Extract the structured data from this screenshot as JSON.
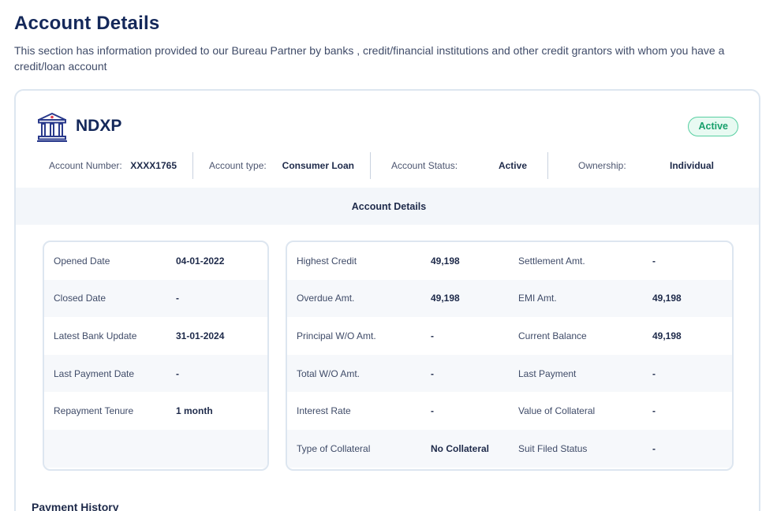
{
  "page": {
    "title": "Account Details",
    "description": "This section has information provided to our Bureau Partner by banks , credit/financial institutions and other credit grantors with whom you have a credit/loan account"
  },
  "account": {
    "bank_icon": "bank-building-icon",
    "name": "NDXP",
    "status_badge": "Active",
    "summary": [
      {
        "label": "Account Number:",
        "value": "XXXX1765"
      },
      {
        "label": "Account type:",
        "value": "Consumer Loan"
      },
      {
        "label": "Account Status:",
        "value": "Active"
      },
      {
        "label": "Ownership:",
        "value": "Individual"
      }
    ],
    "section_title": "Account Details",
    "left_details": [
      {
        "label": "Opened Date",
        "value": "04-01-2022"
      },
      {
        "label": "Closed Date",
        "value": "-"
      },
      {
        "label": "Latest Bank Update",
        "value": "31-01-2024"
      },
      {
        "label": "Last Payment Date",
        "value": "-"
      },
      {
        "label": "Repayment Tenure",
        "value": "1 month"
      },
      {
        "label": "",
        "value": ""
      }
    ],
    "right_details": [
      {
        "label1": "Highest Credit",
        "value1": "49,198",
        "label2": "Settlement Amt.",
        "value2": "-"
      },
      {
        "label1": "Overdue Amt.",
        "value1": "49,198",
        "label2": "EMI Amt.",
        "value2": "49,198"
      },
      {
        "label1": "Principal W/O Amt.",
        "value1": "-",
        "label2": "Current Balance",
        "value2": "49,198"
      },
      {
        "label1": "Total W/O Amt.",
        "value1": "-",
        "label2": "Last Payment",
        "value2": "-"
      },
      {
        "label1": "Interest Rate",
        "value1": "-",
        "label2": "Value of Collateral",
        "value2": "-"
      },
      {
        "label1": "Type of Collateral",
        "value1": "No Collateral",
        "label2": "Suit Filed Status",
        "value2": "-"
      }
    ],
    "payment_history_title": "Payment History"
  },
  "colors": {
    "title": "#14285a",
    "status_green": "#18a06c",
    "status_bg": "#e8faf2",
    "band_bg": "#f3f6fa",
    "border": "#dde6f0"
  }
}
